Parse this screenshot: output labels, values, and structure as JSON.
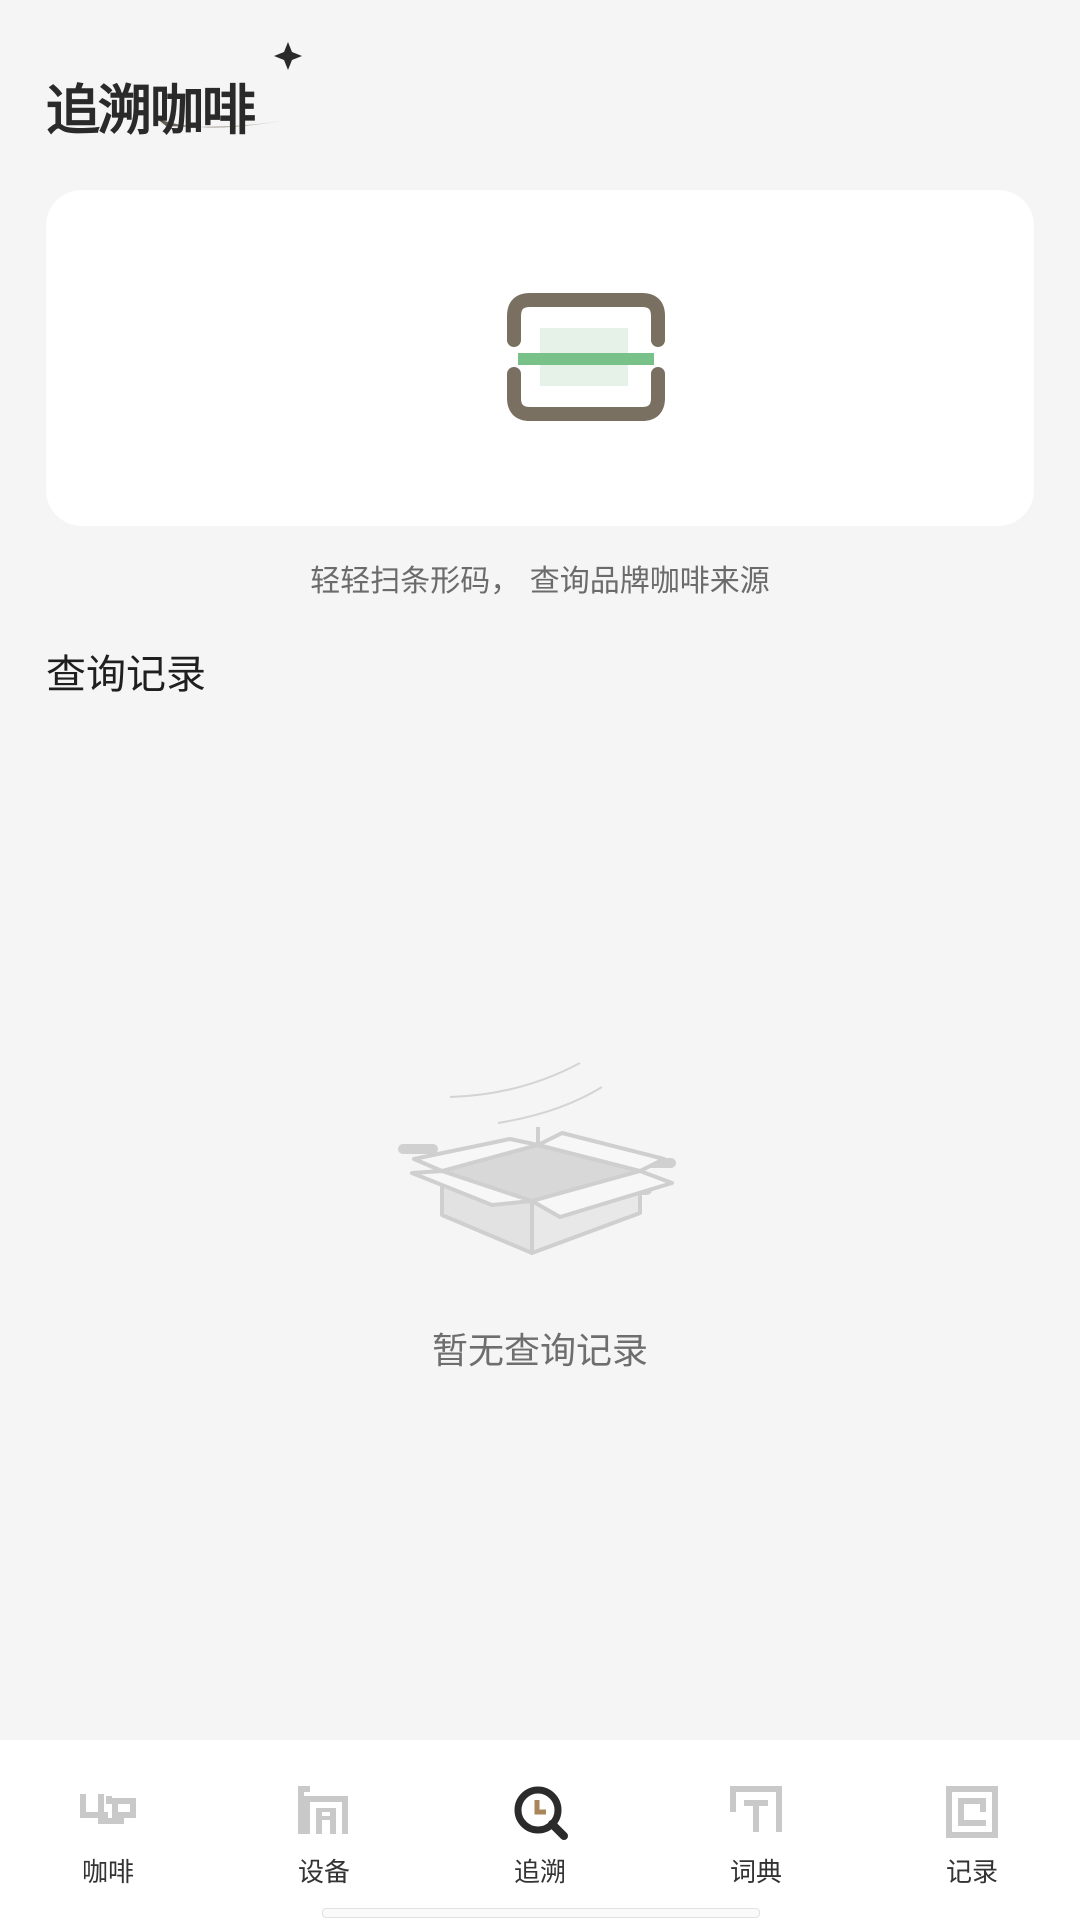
{
  "brand": {
    "logo_text": "追溯咖啡"
  },
  "scan": {
    "hint": "轻轻扫条形码， 查询品牌咖啡来源"
  },
  "history": {
    "title": "查询记录",
    "empty_text": "暂无查询记录"
  },
  "tabbar": {
    "active": "追溯",
    "tabs": [
      {
        "label": "咖啡",
        "icon": "coffee-cup-icon"
      },
      {
        "label": "设备",
        "icon": "device-icon"
      },
      {
        "label": "追溯",
        "icon": "trace-search-icon"
      },
      {
        "label": "词典",
        "icon": "dictionary-icon"
      },
      {
        "label": "记录",
        "icon": "record-icon"
      }
    ]
  },
  "colors": {
    "background": "#f5f5f5",
    "card": "#ffffff",
    "scan_frame": "#7a7061",
    "scan_line": "#78c28a",
    "icon_inactive": "#c9c9c9",
    "icon_active": "#2b2b2b"
  }
}
